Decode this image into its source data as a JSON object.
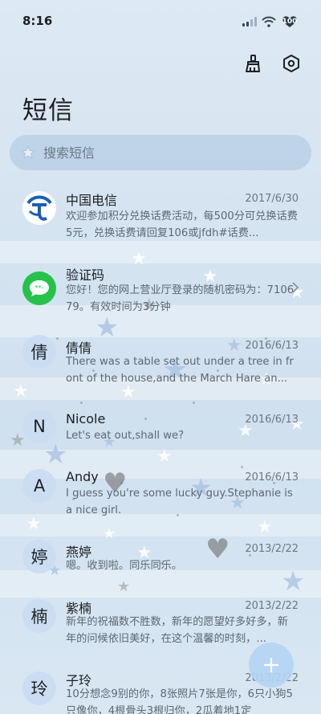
{
  "status_bar": {
    "time": "8:16",
    "battery": "100"
  },
  "header": {
    "title": "短信"
  },
  "search": {
    "placeholder": "搜索短信"
  },
  "conversations": [
    {
      "avatar_icon": "china-telecom-logo",
      "name": "中国电信",
      "date": "2017/6/30",
      "preview": "欢迎参加积分兑换话费活动，每500分可兑换话费5元，兑换话费请回复106或jfdh#话费..."
    },
    {
      "avatar_icon": "chat-bubble-icon",
      "name": "验证码",
      "date": "",
      "preview": "您好！您的网上营业厅登录的随机密码为：710679。有效时间为3分钟"
    },
    {
      "avatar_text": "倩",
      "name": "倩倩",
      "date": "2016/6/13",
      "preview": "There was a table set out under a tree in front of the house,and the March Hare an..."
    },
    {
      "avatar_text": "N",
      "name": "Nicole",
      "date": "2016/6/13",
      "preview": "Let's eat out,shall we?"
    },
    {
      "avatar_text": "A",
      "name": "Andy",
      "date": "2016/6/13",
      "preview": "I guess you're some lucky guy.Stephanie is a nice girl."
    },
    {
      "avatar_text": "婷",
      "name": "燕婷",
      "date": "2013/2/22",
      "preview": "嗯。收到啦。同乐同乐。"
    },
    {
      "avatar_text": "楠",
      "name": "紫楠",
      "date": "2013/2/22",
      "preview": "新年的祝福数不胜数，新年的愿望好多好多，新年的问候依旧美好，在这个温馨的时刻，..."
    },
    {
      "avatar_text": "玲",
      "name": "子玲",
      "date": "2013/2/22",
      "preview": "10分想念9别的你，8张照片7张是你，6只小狗5只像你，4根骨头3根归你，2瓜着地1定"
    }
  ],
  "colors": {
    "telecom_blue": "#1a5fb4",
    "chat_green": "#27c24c",
    "fab": "#b4d4f3"
  }
}
